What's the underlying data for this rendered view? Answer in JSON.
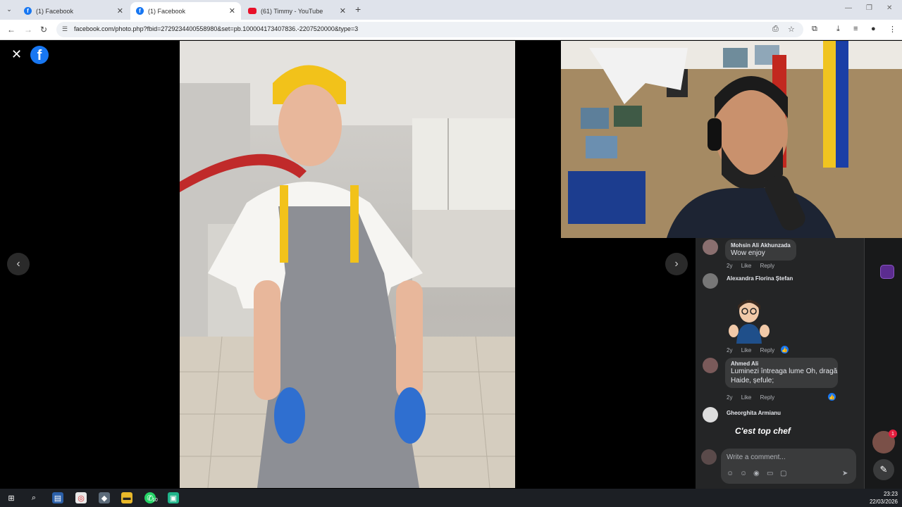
{
  "browser": {
    "tabs": [
      {
        "label": "(1) Facebook",
        "icon": "facebook-icon",
        "active": false
      },
      {
        "label": "(1) Facebook",
        "icon": "facebook-icon",
        "active": true
      },
      {
        "label": "(61) Timmy - YouTube",
        "icon": "youtube-icon",
        "active": false
      }
    ],
    "url": "facebook.com/photo.php?fbid=2729234400558980&set=pb.100004173407836.-2207520000&type=3"
  },
  "comments": [
    {
      "name": "Mohsin Ali Akhunzada",
      "text": "Wow enjoy",
      "time": "2y",
      "like": "Like",
      "reply": "Reply"
    },
    {
      "name": "Alexandra Florina Ștefan",
      "text": "",
      "time": "2y",
      "like": "Like",
      "reply": "Reply",
      "sticker": "thumbs-up-sticker"
    },
    {
      "name": "Ahmed Ali",
      "text_line1": "Luminezi întreaga lume Oh, dragă",
      "text_line2": "Haide, șefule;",
      "time": "2y",
      "like": "Like",
      "reply": "Reply"
    },
    {
      "name": "Gheorghita Armianu",
      "sticker_text": "C'est top chef"
    }
  ],
  "composer": {
    "placeholder": "Write a comment..."
  },
  "rail": {
    "notification_count": "1"
  },
  "taskbar": {
    "time": "23:23",
    "date": "22/03/2026",
    "whatsapp_badge": "10"
  },
  "colors": {
    "facebook_blue": "#1877f2",
    "panel_bg": "#242526",
    "bubble_bg": "#3a3b3c"
  }
}
